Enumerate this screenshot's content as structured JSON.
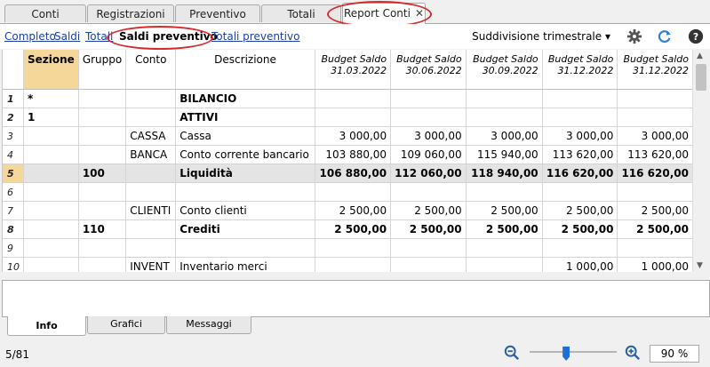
{
  "tabs": [
    "Conti",
    "Registrazioni",
    "Preventivo",
    "Totali",
    "Report Conti"
  ],
  "active_tab_close": "✕",
  "sublinks": [
    "Completo",
    "Saldi",
    "Totali",
    "Saldi preventivo",
    "Totali preventivo"
  ],
  "division_label": "Suddivisione trimestrale",
  "columns": {
    "sezione": "Sezione",
    "gruppo": "Gruppo",
    "conto": "Conto",
    "descrizione": "Descrizione",
    "budget": [
      {
        "line1": "Budget Saldo",
        "line2": "31.03.2022"
      },
      {
        "line1": "Budget Saldo",
        "line2": "30.06.2022"
      },
      {
        "line1": "Budget Saldo",
        "line2": "30.09.2022"
      },
      {
        "line1": "Budget Saldo",
        "line2": "31.12.2022"
      },
      {
        "line1": "Budget Saldo",
        "line2": "31.12.2022"
      }
    ]
  },
  "rows": [
    {
      "n": "1",
      "sezione": "*",
      "gruppo": "",
      "conto": "",
      "descrizione": "BILANCIO",
      "v": [
        "",
        "",
        "",
        "",
        ""
      ],
      "bold": true
    },
    {
      "n": "2",
      "sezione": "1",
      "gruppo": "",
      "conto": "",
      "descrizione": "ATTIVI",
      "v": [
        "",
        "",
        "",
        "",
        ""
      ],
      "bold": true
    },
    {
      "n": "3",
      "sezione": "",
      "gruppo": "",
      "conto": "CASSA",
      "descrizione": "Cassa",
      "v": [
        "3 000,00",
        "3 000,00",
        "3 000,00",
        "3 000,00",
        "3 000,00"
      ],
      "bold": false
    },
    {
      "n": "4",
      "sezione": "",
      "gruppo": "",
      "conto": "BANCA",
      "descrizione": "Conto corrente bancario",
      "v": [
        "103 880,00",
        "109 060,00",
        "115 940,00",
        "113 620,00",
        "113 620,00"
      ],
      "bold": false
    },
    {
      "n": "5",
      "sezione": "",
      "gruppo": "100",
      "conto": "",
      "descrizione": "Liquidità",
      "v": [
        "106 880,00",
        "112 060,00",
        "118 940,00",
        "116 620,00",
        "116 620,00"
      ],
      "bold": true,
      "selected": true
    },
    {
      "n": "6",
      "sezione": "",
      "gruppo": "",
      "conto": "",
      "descrizione": "",
      "v": [
        "",
        "",
        "",
        "",
        ""
      ],
      "bold": false
    },
    {
      "n": "7",
      "sezione": "",
      "gruppo": "",
      "conto": "CLIENTI",
      "descrizione": "Conto clienti",
      "v": [
        "2 500,00",
        "2 500,00",
        "2 500,00",
        "2 500,00",
        "2 500,00"
      ],
      "bold": false
    },
    {
      "n": "8",
      "sezione": "",
      "gruppo": "110",
      "conto": "",
      "descrizione": "Crediti",
      "v": [
        "2 500,00",
        "2 500,00",
        "2 500,00",
        "2 500,00",
        "2 500,00"
      ],
      "bold": true
    },
    {
      "n": "9",
      "sezione": "",
      "gruppo": "",
      "conto": "",
      "descrizione": "",
      "v": [
        "",
        "",
        "",
        "",
        ""
      ],
      "bold": false
    },
    {
      "n": "10",
      "sezione": "",
      "gruppo": "",
      "conto": "INVENT",
      "descrizione": "Inventario merci",
      "v": [
        "",
        "",
        "",
        "1 000,00",
        "1 000,00"
      ],
      "bold": false
    }
  ],
  "bottom_tabs": [
    "Info",
    "Grafici",
    "Messaggi"
  ],
  "status": {
    "row_count": "5/81",
    "zoom": "90 %",
    "zoom_level": 0.42
  },
  "colors": {
    "accent": "#f6d79a",
    "link": "#1a3ea8",
    "highlight": "#d42a2a"
  }
}
